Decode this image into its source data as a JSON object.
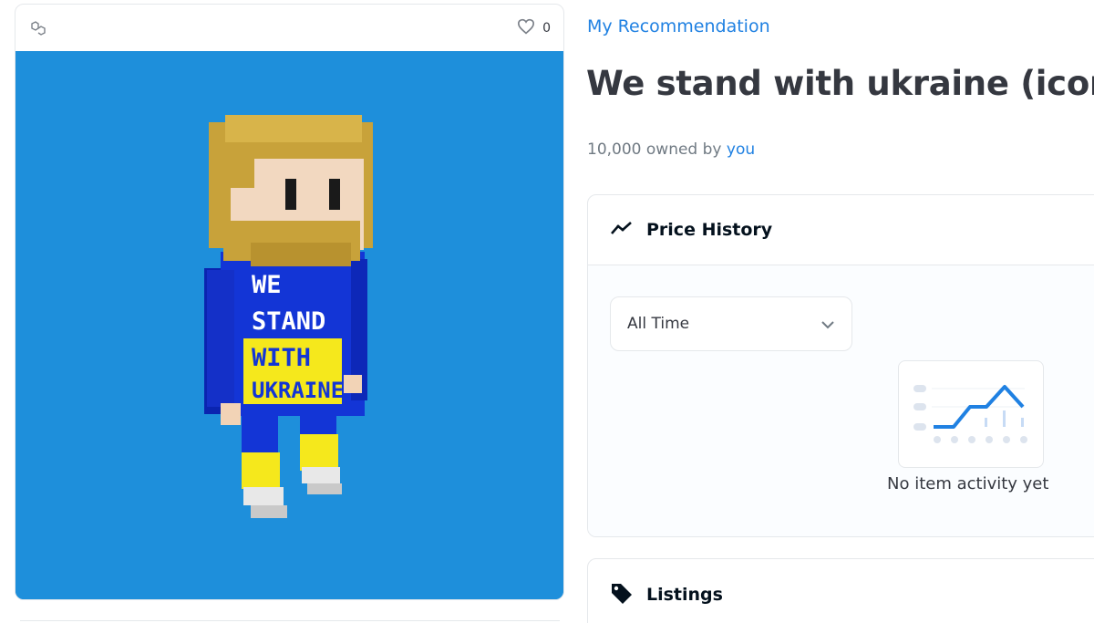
{
  "asset": {
    "favorite_count": "0",
    "image_text": [
      "WE",
      "STAND",
      "WITH",
      "UKRAINE"
    ],
    "background_color": "#1e8fdb"
  },
  "collection": {
    "name": "My Recommendation"
  },
  "item": {
    "title": "We stand with ukraine (icon)",
    "owned_count_text": "10,000 owned by",
    "owner": "you"
  },
  "price_history": {
    "title": "Price History",
    "range_select": "All Time",
    "empty_message": "No item activity yet"
  },
  "listings": {
    "title": "Listings"
  },
  "colors": {
    "link": "#2081e2",
    "heading": "#04111d",
    "accent_chart": "#2081e2"
  }
}
